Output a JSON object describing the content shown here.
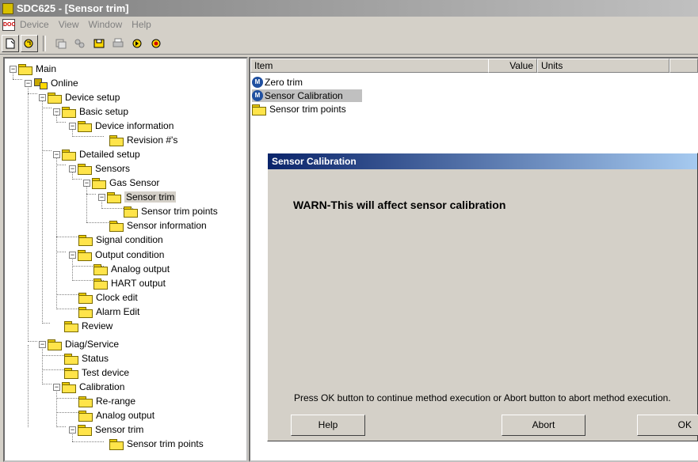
{
  "window": {
    "title": "SDC625 - [Sensor trim]"
  },
  "menu": {
    "doc_icon": "DOC",
    "items": [
      "Device",
      "View",
      "Window",
      "Help"
    ]
  },
  "toolbar": {
    "buttons": [
      "new-document-icon",
      "open-icon",
      "copy-device-icon",
      "device-list-icon",
      "save-icon",
      "print-icon",
      "refresh-icon",
      "stop-icon"
    ]
  },
  "tree": {
    "items": [
      {
        "label": "Main"
      },
      {
        "label": "Online"
      },
      {
        "label": "Device setup"
      },
      {
        "label": "Basic setup"
      },
      {
        "label": "Device information"
      },
      {
        "label": "Revision #'s"
      },
      {
        "label": "Detailed setup"
      },
      {
        "label": "Sensors"
      },
      {
        "label": "Gas Sensor"
      },
      {
        "label": "Sensor trim"
      },
      {
        "label": "Sensor trim points"
      },
      {
        "label": "Sensor information"
      },
      {
        "label": "Signal condition"
      },
      {
        "label": "Output condition"
      },
      {
        "label": "Analog output"
      },
      {
        "label": "HART output"
      },
      {
        "label": "Clock edit"
      },
      {
        "label": "Alarm Edit"
      },
      {
        "label": "Review"
      },
      {
        "label": "Diag/Service"
      },
      {
        "label": "Status"
      },
      {
        "label": "Test device"
      },
      {
        "label": "Calibration"
      },
      {
        "label": "Re-range"
      },
      {
        "label": "Analog output"
      },
      {
        "label": "Sensor trim"
      },
      {
        "label": "Sensor trim points"
      }
    ]
  },
  "list": {
    "columns": [
      "Item",
      "Value",
      "Units"
    ],
    "rows": [
      "Zero trim",
      "Sensor Calibration",
      "Sensor trim points"
    ]
  },
  "dialog": {
    "title": "Sensor Calibration",
    "warning": "WARN-This will affect sensor calibration",
    "message": "Press OK button to continue method execution or Abort button to abort method execution.",
    "help_label": "Help",
    "abort_label": "Abort",
    "ok_label": "OK"
  }
}
